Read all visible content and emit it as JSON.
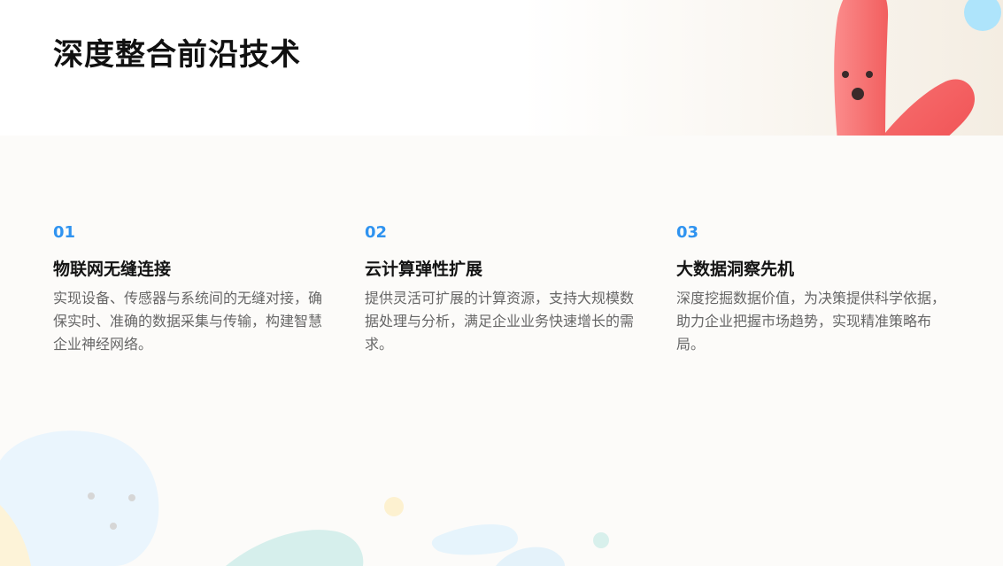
{
  "slide": {
    "title": "深度整合前沿技术",
    "cards": [
      {
        "number": "01",
        "title": "物联网无缝连接",
        "description": "实现设备、传感器与系统间的无缝对接，确保实时、准确的数据采集与传输，构建智慧企业神经网络。"
      },
      {
        "number": "02",
        "title": "云计算弹性扩展",
        "description": "提供灵活可扩展的计算资源，支持大规模数据处理与分析，满足企业业务快速增长的需求。"
      },
      {
        "number": "03",
        "title": "大数据洞察先机",
        "description": "深度挖掘数据价值，为决策提供科学依据，助力企业把握市场趋势，实现精准策略布局。"
      }
    ]
  },
  "colors": {
    "accent": "#2f93f0",
    "title_text": "#111111",
    "body_text": "#666666",
    "mascot_red": "#f46a6a",
    "blob_blue": "#aee4fb",
    "blob_teal": "#d6efec"
  },
  "decorations": [
    "red-mascot-icon",
    "blue-circle-icon",
    "background-blobs"
  ]
}
